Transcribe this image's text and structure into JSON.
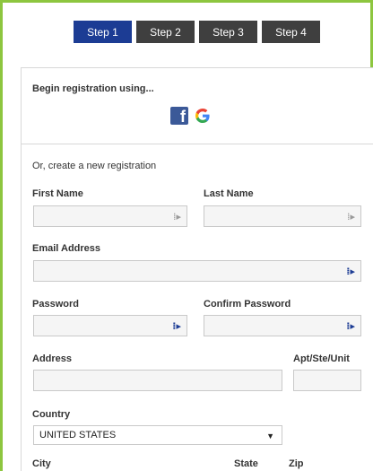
{
  "steps": [
    "Step 1",
    "Step 2",
    "Step 3",
    "Step 4"
  ],
  "social": {
    "heading": "Begin registration using...",
    "facebook_glyph": "f",
    "google_glyph": "G"
  },
  "form": {
    "heading": "Or, create a new registration",
    "first_name_label": "First Name",
    "last_name_label": "Last Name",
    "email_label": "Email Address",
    "password_label": "Password",
    "confirm_password_label": "Confirm Password",
    "address_label": "Address",
    "apt_label": "Apt/Ste/Unit",
    "country_label": "Country",
    "country_value": "UNITED STATES",
    "city_label": "City",
    "state_label": "State",
    "zip_label": "Zip"
  },
  "field_icon_glyph": "⁞▸",
  "colors": {
    "accent_border": "#8dc63f",
    "step_active": "#1c3c94",
    "step_inactive": "#3f3f3f",
    "facebook": "#3b5998"
  }
}
